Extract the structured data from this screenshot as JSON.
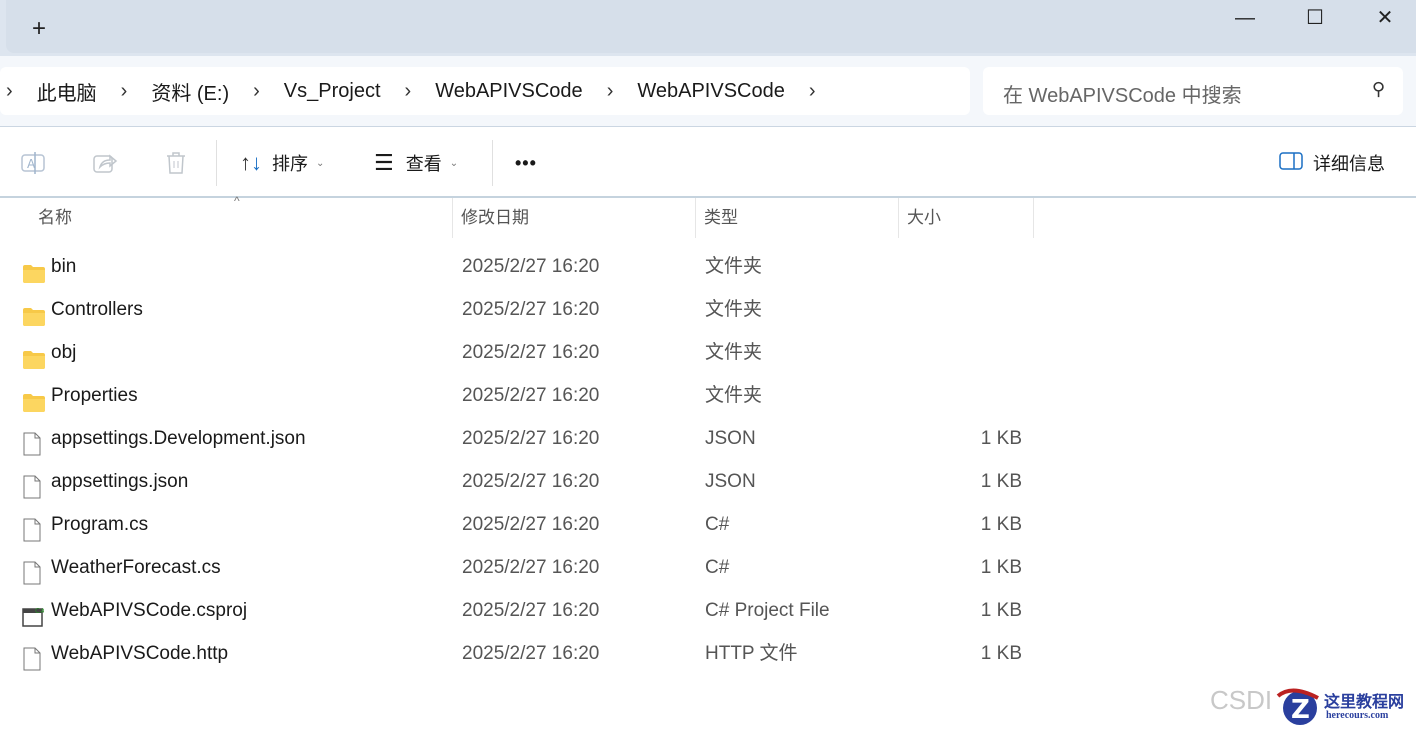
{
  "window": {
    "new_tab": "+",
    "minimize": "—",
    "maximize": "☐",
    "close": "✕"
  },
  "breadcrumb": [
    "此电脑",
    "资料 (E:)",
    "Vs_Project",
    "WebAPIVSCode",
    "WebAPIVSCode"
  ],
  "search": {
    "placeholder": "在 WebAPIVSCode 中搜索"
  },
  "toolbar": {
    "sort": "排序",
    "view": "查看",
    "more": "•••",
    "details": "详细信息"
  },
  "columns": {
    "name": "名称",
    "date": "修改日期",
    "type": "类型",
    "size": "大小"
  },
  "files": [
    {
      "name": "bin",
      "date": "2025/2/27 16:20",
      "type": "文件夹",
      "size": "",
      "kind": "folder"
    },
    {
      "name": "Controllers",
      "date": "2025/2/27 16:20",
      "type": "文件夹",
      "size": "",
      "kind": "folder"
    },
    {
      "name": "obj",
      "date": "2025/2/27 16:20",
      "type": "文件夹",
      "size": "",
      "kind": "folder"
    },
    {
      "name": "Properties",
      "date": "2025/2/27 16:20",
      "type": "文件夹",
      "size": "",
      "kind": "folder"
    },
    {
      "name": "appsettings.Development.json",
      "date": "2025/2/27 16:20",
      "type": "JSON",
      "size": "1 KB",
      "kind": "file"
    },
    {
      "name": "appsettings.json",
      "date": "2025/2/27 16:20",
      "type": "JSON",
      "size": "1 KB",
      "kind": "file"
    },
    {
      "name": "Program.cs",
      "date": "2025/2/27 16:20",
      "type": "C#",
      "size": "1 KB",
      "kind": "file"
    },
    {
      "name": "WeatherForecast.cs",
      "date": "2025/2/27 16:20",
      "type": "C#",
      "size": "1 KB",
      "kind": "file"
    },
    {
      "name": "WebAPIVSCode.csproj",
      "date": "2025/2/27 16:20",
      "type": "C# Project File",
      "size": "1 KB",
      "kind": "csproj"
    },
    {
      "name": "WebAPIVSCode.http",
      "date": "2025/2/27 16:20",
      "type": "HTTP 文件",
      "size": "1 KB",
      "kind": "file"
    }
  ],
  "watermark": {
    "text": "CSDI",
    "logo": "这里教程网 herecours.com"
  }
}
